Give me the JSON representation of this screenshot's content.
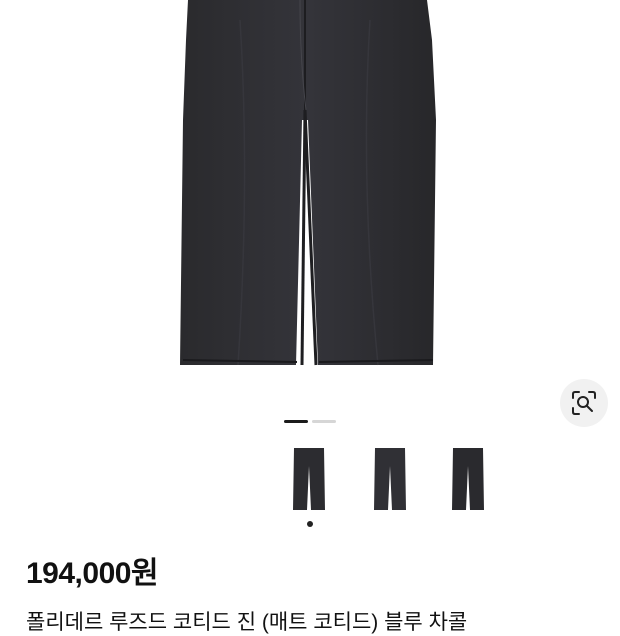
{
  "product": {
    "price": "194,000원",
    "name": "폴리데르 루즈드 코티드 진 (매트 코티드) 블루 차콜"
  },
  "gallery": {
    "total_pages": 2,
    "active_page": 1,
    "thumbnail_count": 3,
    "selected_thumbnail": 1
  },
  "icons": {
    "lens": "visual-search-icon"
  },
  "colors": {
    "jeans": "#2b2b2e",
    "pager_active": "#1b1b1b",
    "pager_inactive": "#d6d6d6"
  }
}
